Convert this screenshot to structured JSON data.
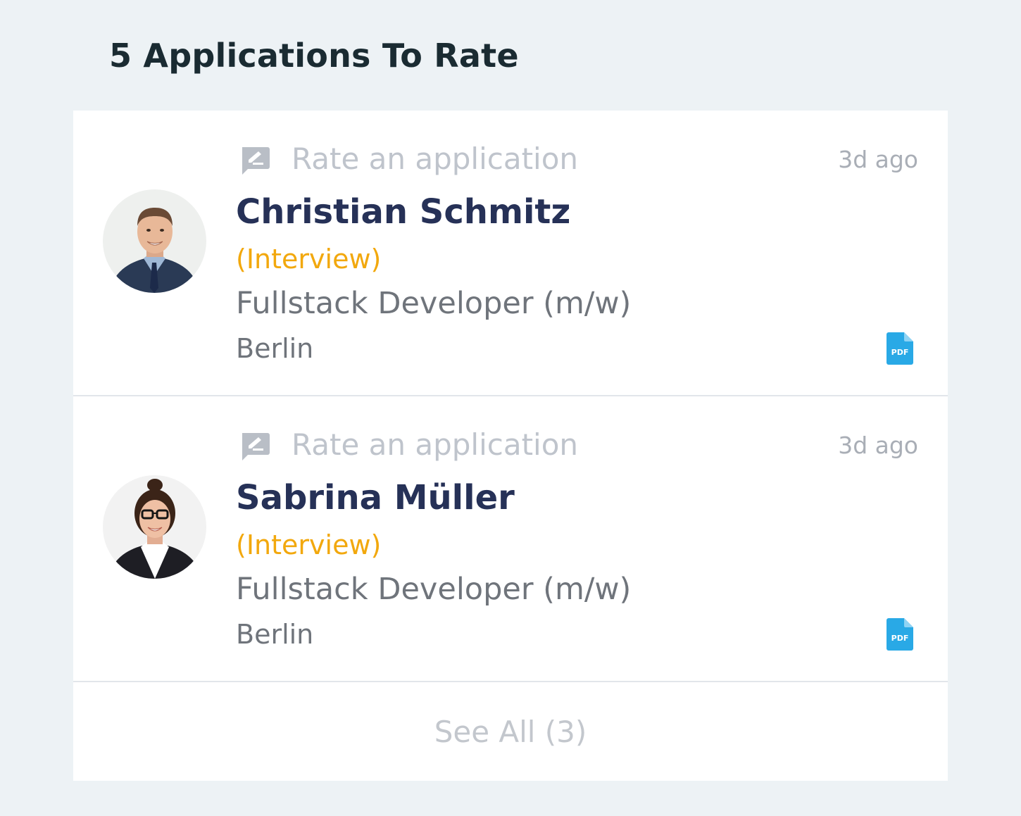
{
  "header": {
    "title": "5 Applications To Rate"
  },
  "applications": [
    {
      "action_label": "Rate an application",
      "time_ago": "3d ago",
      "name": "Christian Schmitz",
      "stage": "(Interview)",
      "job_title": "Fullstack Developer (m/w)",
      "location": "Berlin",
      "attachment": "pdf-icon"
    },
    {
      "action_label": "Rate an application",
      "time_ago": "3d ago",
      "name": "Sabrina Müller",
      "stage": "(Interview)",
      "job_title": "Fullstack Developer (m/w)",
      "location": "Berlin",
      "attachment": "pdf-icon"
    }
  ],
  "footer": {
    "see_all_label": "See All (3)"
  },
  "colors": {
    "background": "#edf2f5",
    "card": "#ffffff",
    "name": "#263157",
    "stage": "#f2a80d",
    "pdf": "#29a9e6",
    "muted": "#bfc4cc"
  }
}
